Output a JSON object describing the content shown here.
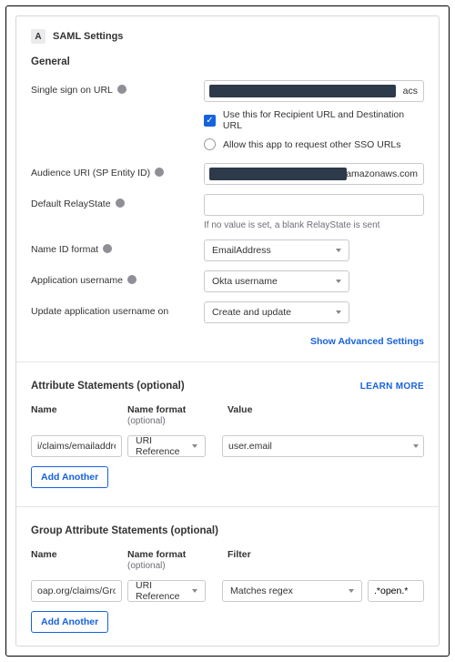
{
  "step": "A",
  "title": "SAML Settings",
  "sections": {
    "general": {
      "heading": "General",
      "sso": {
        "label": "Single sign on URL",
        "suffix": "acs",
        "check1": "Use this for Recipient URL and Destination URL",
        "check2": "Allow this app to request other SSO URLs"
      },
      "audience": {
        "label": "Audience URI (SP Entity ID)",
        "suffix": "amazonaws.com"
      },
      "relay": {
        "label": "Default RelayState",
        "value": "",
        "note": "If no value is set, a blank RelayState is sent"
      },
      "nameid": {
        "label": "Name ID format",
        "value": "EmailAddress"
      },
      "appuser": {
        "label": "Application username",
        "value": "Okta username"
      },
      "updateon": {
        "label": "Update application username on",
        "value": "Create and update"
      },
      "advanced": "Show Advanced Settings"
    },
    "attrs": {
      "heading": "Attribute Statements (optional)",
      "learn": "LEARN MORE",
      "hdr_name": "Name",
      "hdr_fmt": "Name format",
      "hdr_fmt_sub": "(optional)",
      "hdr_val": "Value",
      "row": {
        "name_val": "i/claims/emailaddres",
        "fmt_val": "URI Reference",
        "val_val": "user.email"
      },
      "add": "Add Another"
    },
    "group_attrs": {
      "heading": "Group Attribute Statements (optional)",
      "hdr_name": "Name",
      "hdr_fmt": "Name format",
      "hdr_fmt_sub": "(optional)",
      "hdr_filter": "Filter",
      "row": {
        "name_val": "oap.org/claims/Grou",
        "fmt_val": "URI Reference",
        "filter_val": "Matches regex",
        "pattern_val": ".*open.*"
      },
      "add": "Add Another"
    }
  }
}
